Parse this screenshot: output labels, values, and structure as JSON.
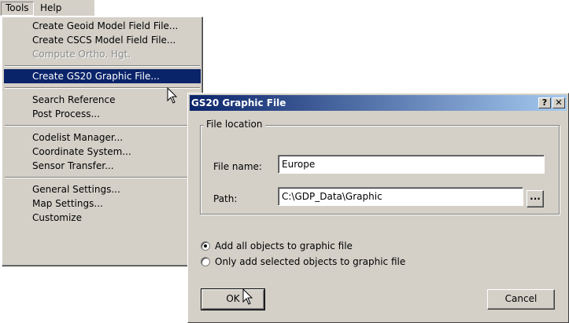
{
  "menubar": {
    "tools": "Tools",
    "help": "Help"
  },
  "tools_menu": {
    "items": [
      {
        "label": "Create Geoid Model Field File...",
        "disabled": false
      },
      {
        "label": "Create CSCS Model Field File...",
        "disabled": false
      },
      {
        "label": "Compute Ortho. Hgt.",
        "disabled": true
      },
      {
        "label": "Create GS20 Graphic File...",
        "selected": true
      },
      {
        "label": "Search Reference"
      },
      {
        "label": "Post Process..."
      },
      {
        "label": "Codelist Manager..."
      },
      {
        "label": "Coordinate System..."
      },
      {
        "label": "Sensor Transfer..."
      },
      {
        "label": "General Settings..."
      },
      {
        "label": "Map Settings..."
      },
      {
        "label": "Customize"
      }
    ]
  },
  "dialog": {
    "title": "GS20 Graphic File",
    "help_button": "?",
    "close_button": "✕",
    "group_label": "File location",
    "file_name_label": "File name:",
    "file_name_value": "Europe",
    "path_label": "Path:",
    "path_value": "C:\\GDP_Data\\Graphic",
    "browse_label": "...",
    "radio_all": "Add all objects to graphic file",
    "radio_selected": "Only add selected objects to graphic file",
    "radio_all_checked": true,
    "ok_label": "OK",
    "cancel_label": "Cancel"
  },
  "colors": {
    "face": "#d4d0c8",
    "title_start": "#0a246a",
    "title_end": "#a6caf0",
    "highlight": "#0a246a"
  }
}
